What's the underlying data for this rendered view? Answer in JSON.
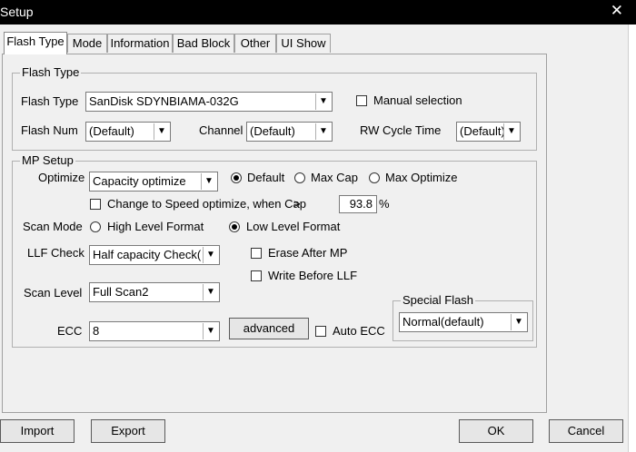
{
  "window": {
    "title": "Setup",
    "close_glyph": "✕"
  },
  "tabs": [
    {
      "label": "Flash Type"
    },
    {
      "label": "Mode"
    },
    {
      "label": "Information"
    },
    {
      "label": "Bad Block"
    },
    {
      "label": "Other"
    },
    {
      "label": "UI Show"
    }
  ],
  "active_tab": "Flash Type",
  "flash_type_group": {
    "legend": "Flash Type",
    "flash_type_label": "Flash Type",
    "flash_type_value": "SanDisk SDYNBIAMA-032G",
    "manual_selection_label": "Manual selection",
    "manual_selection_checked": false,
    "flash_num_label": "Flash Num",
    "flash_num_value": "(Default)",
    "channel_label": "Channel",
    "channel_value": "(Default)",
    "rw_cycle_label": "RW Cycle Time",
    "rw_cycle_value": "(Default)"
  },
  "mp_setup_group": {
    "legend": "MP Setup",
    "optimize_label": "Optimize",
    "optimize_value": "Capacity optimize",
    "optimize_radios": [
      {
        "label": "Default",
        "selected": true
      },
      {
        "label": "Max Cap",
        "selected": false
      },
      {
        "label": "Max Optimize",
        "selected": false
      }
    ],
    "speed_checkbox_label": "Change to Speed optimize, when Cap",
    "speed_checkbox_checked": false,
    "gt_symbol": ">",
    "cap_threshold_value": "93.8",
    "percent_symbol": "%",
    "scan_mode_label": "Scan Mode",
    "scan_mode_radios": [
      {
        "label": "High Level Format",
        "selected": false
      },
      {
        "label": "Low Level Format",
        "selected": true
      }
    ],
    "llf_check_label": "LLF Check",
    "llf_check_value": "Half capacity Check(D",
    "erase_after_mp_label": "Erase After MP",
    "erase_after_mp_checked": false,
    "write_before_llf_label": "Write Before LLF",
    "write_before_llf_checked": false,
    "scan_level_label": "Scan Level",
    "scan_level_value": "Full Scan2",
    "ecc_label": "ECC",
    "ecc_value": "8",
    "advanced_button_label": "advanced",
    "auto_ecc_label": "Auto ECC",
    "auto_ecc_checked": false,
    "special_flash": {
      "legend": "Special Flash",
      "value": "Normal(default)"
    }
  },
  "footer": {
    "import_label": "Import",
    "export_label": "Export",
    "ok_label": "OK",
    "cancel_label": "Cancel"
  },
  "icons": {
    "dropdown_arrow": "▼"
  }
}
